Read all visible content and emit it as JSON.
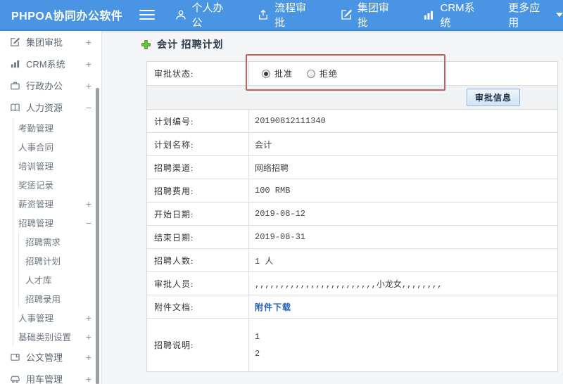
{
  "navbar": {
    "logo": "PHPOA协同办公软件",
    "items": [
      {
        "label": "个人办公",
        "icon": "user-icon"
      },
      {
        "label": "流程审批",
        "icon": "process-approval-icon"
      },
      {
        "label": "集团审批",
        "icon": "edit-square-icon"
      },
      {
        "label": "CRM系统",
        "icon": "bar-chart-icon"
      },
      {
        "label": "更多应用",
        "icon": "caret-down-icon"
      }
    ]
  },
  "sidebar": {
    "items": [
      {
        "label": "集团审批",
        "icon": "edit-square-icon",
        "toggle": "+",
        "level": 0
      },
      {
        "label": "CRM系统",
        "icon": "bar-chart-icon",
        "toggle": "+",
        "level": 0
      },
      {
        "label": "行政办公",
        "icon": "briefcase-icon",
        "toggle": "+",
        "level": 0
      },
      {
        "label": "人力资源",
        "icon": "book-icon",
        "toggle": "−",
        "level": 0,
        "expanded": true
      },
      {
        "label": "考勤管理",
        "level": 1
      },
      {
        "label": "人事合同",
        "level": 1
      },
      {
        "label": "培训管理",
        "level": 1
      },
      {
        "label": "奖惩记录",
        "level": 1
      },
      {
        "label": "薪资管理",
        "toggle": "+",
        "level": 1
      },
      {
        "label": "招聘管理",
        "toggle": "−",
        "level": 1,
        "expanded": true
      },
      {
        "label": "招聘需求",
        "level": 2
      },
      {
        "label": "招聘计划",
        "level": 2
      },
      {
        "label": "人才库",
        "level": 2
      },
      {
        "label": "招聘录用",
        "level": 2
      },
      {
        "label": "人事管理",
        "toggle": "+",
        "level": 1
      },
      {
        "label": "基础类别设置",
        "toggle": "+",
        "level": 1
      },
      {
        "label": "公文管理",
        "icon": "document-icon",
        "toggle": "+",
        "level": 0
      },
      {
        "label": "用车管理",
        "icon": "car-icon",
        "toggle": "+",
        "level": 0
      }
    ]
  },
  "content": {
    "title": "会计 招聘计划",
    "title_icon": "add-plus-icon",
    "approval": {
      "label": "审批状态:",
      "options": [
        {
          "label": "批准",
          "selected": true
        },
        {
          "label": "拒绝",
          "selected": false
        }
      ]
    },
    "action_button_label": "审批信息",
    "rows": [
      {
        "label": "计划编号:",
        "value": "20190812111340"
      },
      {
        "label": "计划名称:",
        "value": "会计"
      },
      {
        "label": "招聘渠道:",
        "value": "网络招聘"
      },
      {
        "label": "招聘费用:",
        "value": "100 RMB"
      },
      {
        "label": "开始日期:",
        "value": "2019-08-12"
      },
      {
        "label": "结束日期:",
        "value": "2019-08-31"
      },
      {
        "label": "招聘人数:",
        "value": "1 人"
      },
      {
        "label": "审批人员:",
        "value": ",,,,,,,,,,,,,,,,,,,,,,,,小龙女,,,,,,,,"
      },
      {
        "label": "附件文档:",
        "value": "附件下载",
        "type": "link"
      },
      {
        "label": "招聘说明:",
        "lines": [
          "1",
          "2"
        ]
      }
    ],
    "colors": {
      "navbar_blue": "#4a94e4",
      "annotation_red": "#c4615e",
      "link_blue": "#2462b8",
      "plus_green": "#72bf3a"
    }
  }
}
